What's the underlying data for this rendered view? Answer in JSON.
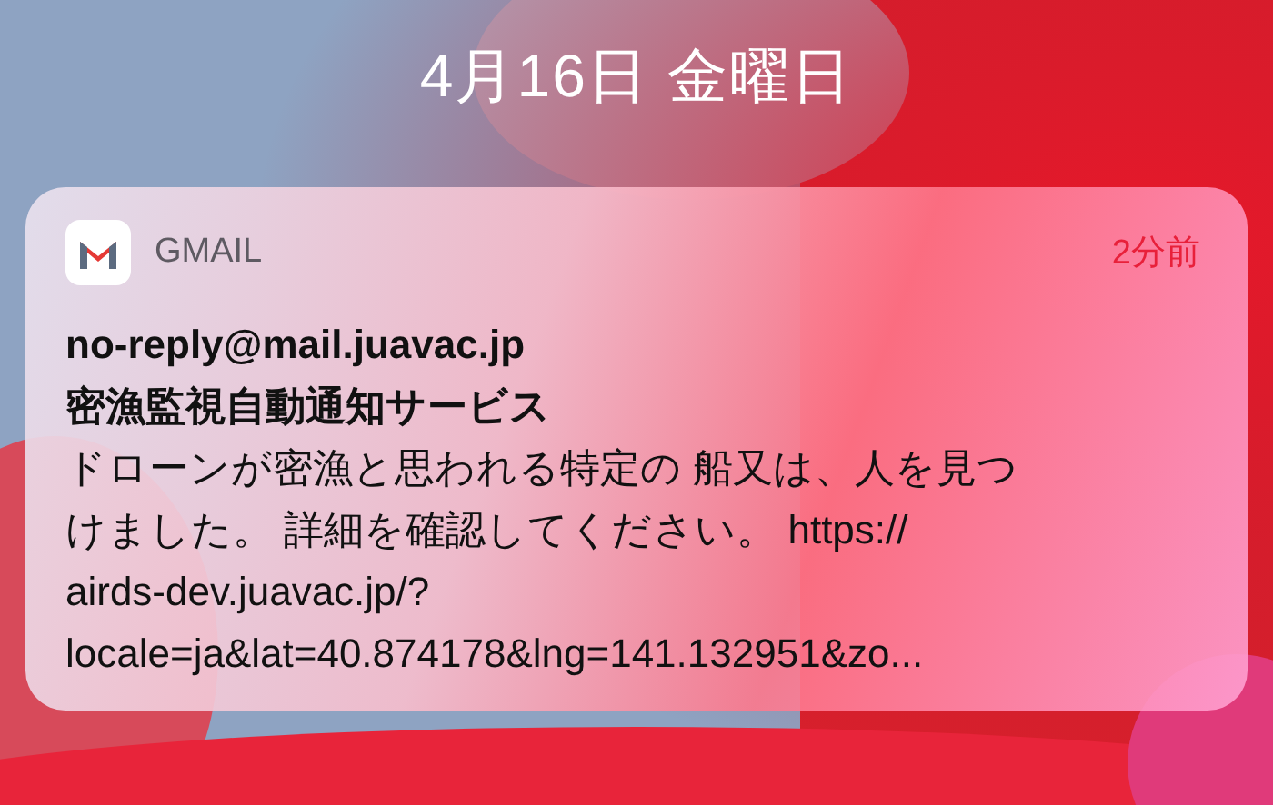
{
  "lock_screen": {
    "date": "4月16日 金曜日"
  },
  "notification": {
    "app_name": "GMAIL",
    "time": "2分前",
    "sender": "no-reply@mail.juavac.jp",
    "subject": "密漁監視自動通知サービス",
    "body_lines": [
      "ドローンが密漁と思われる特定の 船又は、人を見つ",
      "けました。 詳細を確認してください。 https://",
      "airds-dev.juavac.jp/?",
      "locale=ja&lat=40.874178&lng=141.132951&zo..."
    ]
  }
}
